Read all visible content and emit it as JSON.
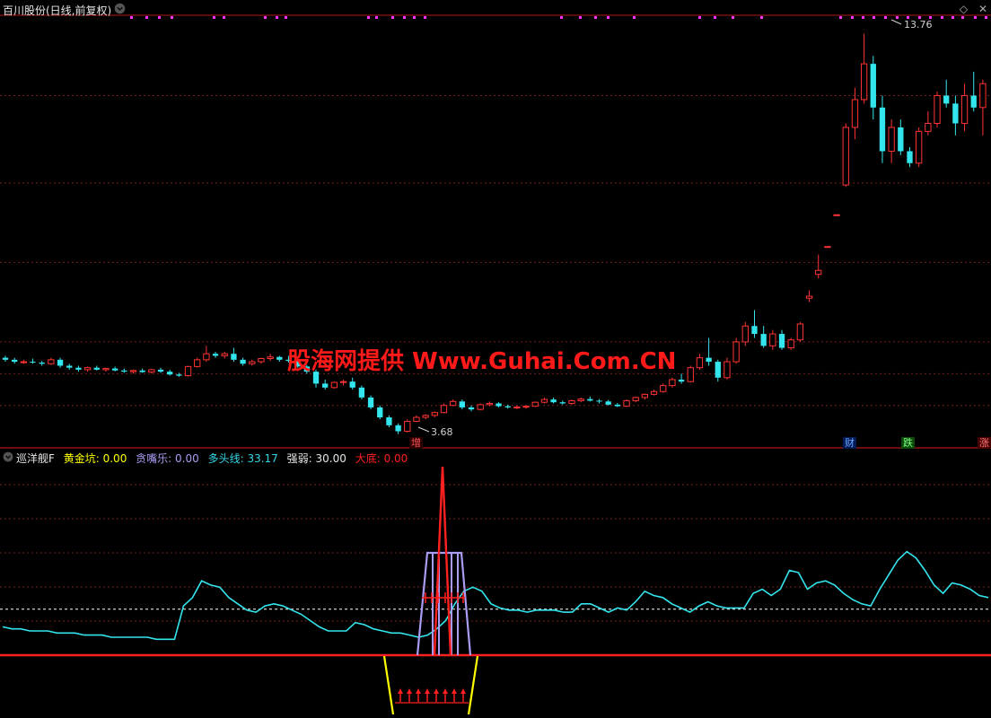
{
  "header": {
    "title": "百川股份(日线,前复权)",
    "window_controls": [
      "◇",
      "✕"
    ]
  },
  "price": {
    "high_label": "13.76",
    "low_label": "3.68"
  },
  "event_badges": {
    "zeng": "增",
    "cai": "财",
    "die": "跌",
    "zhang": "涨"
  },
  "indicator": {
    "name": "巡洋舰F",
    "items": [
      {
        "key": "黄金坑",
        "value": "0.00",
        "color": "#ffff00"
      },
      {
        "key": "贪嘴乐",
        "value": "0.00",
        "color": "#a99cf2"
      },
      {
        "key": "多头线",
        "value": "33.17",
        "color": "#33d6e6"
      },
      {
        "key": "强弱",
        "value": "30.00",
        "color": "#e6e6e6"
      },
      {
        "key": "大底",
        "value": "0.00",
        "color": "#ff2020"
      }
    ]
  },
  "watermark": "股海网提供 Www.Guhai.Com.CN",
  "colors": {
    "up": "#ff3333",
    "down": "#33e6ee",
    "grid": "#7a1f1f",
    "signal_dots": "#ff33ff"
  },
  "chart_data": {
    "type": "candlestick",
    "candles": [
      [
        5.6,
        5.65,
        5.5,
        5.55
      ],
      [
        5.55,
        5.6,
        5.45,
        5.5
      ],
      [
        5.5,
        5.55,
        5.45,
        5.5
      ],
      [
        5.5,
        5.58,
        5.45,
        5.48
      ],
      [
        5.48,
        5.52,
        5.4,
        5.45
      ],
      [
        5.45,
        5.6,
        5.42,
        5.55
      ],
      [
        5.55,
        5.6,
        5.35,
        5.4
      ],
      [
        5.4,
        5.45,
        5.3,
        5.35
      ],
      [
        5.35,
        5.4,
        5.25,
        5.3
      ],
      [
        5.3,
        5.38,
        5.25,
        5.35
      ],
      [
        5.35,
        5.4,
        5.28,
        5.3
      ],
      [
        5.3,
        5.35,
        5.25,
        5.33
      ],
      [
        5.33,
        5.38,
        5.26,
        5.28
      ],
      [
        5.28,
        5.33,
        5.22,
        5.25
      ],
      [
        5.25,
        5.3,
        5.2,
        5.28
      ],
      [
        5.28,
        5.33,
        5.22,
        5.24
      ],
      [
        5.24,
        5.32,
        5.2,
        5.3
      ],
      [
        5.3,
        5.35,
        5.22,
        5.25
      ],
      [
        5.25,
        5.3,
        5.15,
        5.18
      ],
      [
        5.18,
        5.22,
        5.12,
        5.15
      ],
      [
        5.15,
        5.4,
        5.12,
        5.38
      ],
      [
        5.38,
        5.6,
        5.35,
        5.55
      ],
      [
        5.55,
        5.9,
        5.5,
        5.7
      ],
      [
        5.7,
        5.75,
        5.6,
        5.65
      ],
      [
        5.65,
        5.75,
        5.58,
        5.7
      ],
      [
        5.7,
        5.85,
        5.5,
        5.55
      ],
      [
        5.55,
        5.6,
        5.4,
        5.45
      ],
      [
        5.45,
        5.55,
        5.4,
        5.5
      ],
      [
        5.5,
        5.6,
        5.45,
        5.58
      ],
      [
        5.58,
        5.7,
        5.52,
        5.62
      ],
      [
        5.62,
        5.65,
        5.5,
        5.55
      ],
      [
        5.55,
        5.65,
        5.48,
        5.52
      ],
      [
        5.52,
        5.55,
        5.35,
        5.38
      ],
      [
        5.38,
        5.42,
        5.2,
        5.25
      ],
      [
        5.25,
        5.3,
        4.85,
        4.95
      ],
      [
        4.95,
        5.05,
        4.8,
        4.85
      ],
      [
        4.85,
        5.0,
        4.82,
        4.98
      ],
      [
        4.98,
        5.05,
        4.9,
        5.0
      ],
      [
        5.0,
        5.1,
        4.8,
        4.85
      ],
      [
        4.85,
        4.9,
        4.55,
        4.6
      ],
      [
        4.6,
        4.65,
        4.3,
        4.35
      ],
      [
        4.35,
        4.4,
        4.05,
        4.1
      ],
      [
        4.1,
        4.15,
        3.85,
        3.9
      ],
      [
        3.9,
        3.95,
        3.68,
        3.75
      ],
      [
        3.75,
        4.05,
        3.72,
        4.0
      ],
      [
        4.0,
        4.15,
        3.98,
        4.1
      ],
      [
        4.1,
        4.18,
        4.05,
        4.15
      ],
      [
        4.15,
        4.25,
        4.1,
        4.22
      ],
      [
        4.22,
        4.45,
        4.2,
        4.4
      ],
      [
        4.4,
        4.55,
        4.38,
        4.5
      ],
      [
        4.5,
        4.55,
        4.3,
        4.35
      ],
      [
        4.35,
        4.4,
        4.25,
        4.3
      ],
      [
        4.3,
        4.45,
        4.28,
        4.42
      ],
      [
        4.42,
        4.5,
        4.38,
        4.45
      ],
      [
        4.45,
        4.48,
        4.35,
        4.38
      ],
      [
        4.38,
        4.42,
        4.32,
        4.35
      ],
      [
        4.35,
        4.4,
        4.3,
        4.36
      ],
      [
        4.36,
        4.4,
        4.32,
        4.38
      ],
      [
        4.38,
        4.5,
        4.36,
        4.48
      ],
      [
        4.48,
        4.6,
        4.45,
        4.55
      ],
      [
        4.55,
        4.6,
        4.45,
        4.48
      ],
      [
        4.48,
        4.52,
        4.42,
        4.45
      ],
      [
        4.45,
        4.55,
        4.42,
        4.52
      ],
      [
        4.52,
        4.6,
        4.48,
        4.56
      ],
      [
        4.56,
        4.62,
        4.5,
        4.52
      ],
      [
        4.52,
        4.56,
        4.45,
        4.5
      ],
      [
        4.5,
        4.54,
        4.4,
        4.42
      ],
      [
        4.42,
        4.46,
        4.36,
        4.38
      ],
      [
        4.38,
        4.55,
        4.36,
        4.52
      ],
      [
        4.52,
        4.62,
        4.48,
        4.6
      ],
      [
        4.6,
        4.7,
        4.55,
        4.68
      ],
      [
        4.68,
        4.8,
        4.65,
        4.75
      ],
      [
        4.75,
        4.95,
        4.72,
        4.9
      ],
      [
        4.9,
        5.1,
        4.85,
        5.05
      ],
      [
        5.05,
        5.2,
        4.95,
        5.0
      ],
      [
        5.0,
        5.4,
        4.98,
        5.35
      ],
      [
        5.35,
        5.7,
        5.3,
        5.6
      ],
      [
        5.6,
        6.1,
        5.4,
        5.5
      ],
      [
        5.5,
        5.55,
        5.0,
        5.1
      ],
      [
        5.1,
        5.6,
        5.05,
        5.5
      ],
      [
        5.5,
        6.1,
        5.45,
        6.0
      ],
      [
        6.0,
        6.5,
        5.9,
        6.4
      ],
      [
        6.4,
        6.8,
        6.1,
        6.2
      ],
      [
        6.2,
        6.4,
        5.85,
        5.9
      ],
      [
        5.9,
        6.3,
        5.8,
        6.2
      ],
      [
        6.2,
        6.3,
        5.8,
        5.85
      ],
      [
        5.85,
        6.1,
        5.8,
        6.05
      ],
      [
        6.05,
        6.5,
        6.0,
        6.45
      ],
      [
        7.1,
        7.3,
        7.0,
        7.15
      ],
      [
        7.7,
        8.2,
        7.6,
        7.8
      ],
      [
        8.4,
        8.4,
        8.4,
        8.4
      ],
      [
        9.2,
        9.2,
        9.2,
        9.2
      ],
      [
        9.95,
        11.5,
        9.9,
        11.4
      ],
      [
        11.4,
        12.4,
        11.1,
        12.1
      ],
      [
        12.1,
        13.76,
        12.0,
        13.0
      ],
      [
        13.0,
        13.2,
        11.6,
        11.9
      ],
      [
        11.9,
        12.2,
        10.5,
        10.8
      ],
      [
        10.8,
        11.6,
        10.5,
        11.4
      ],
      [
        11.4,
        11.6,
        10.7,
        10.8
      ],
      [
        10.8,
        10.9,
        10.4,
        10.5
      ],
      [
        10.5,
        11.4,
        10.4,
        11.3
      ],
      [
        11.3,
        11.8,
        11.2,
        11.5
      ],
      [
        11.5,
        12.3,
        11.4,
        12.2
      ],
      [
        12.2,
        12.6,
        11.9,
        12.0
      ],
      [
        12.0,
        12.2,
        11.2,
        11.5
      ],
      [
        11.5,
        12.5,
        11.3,
        12.2
      ],
      [
        12.2,
        12.8,
        11.8,
        11.9
      ],
      [
        11.9,
        12.6,
        11.2,
        12.5
      ]
    ],
    "price_range": [
      3.4,
      14.2
    ],
    "multi_line": [
      22,
      21,
      21,
      20,
      20,
      20,
      19,
      19,
      19,
      18,
      18,
      18,
      17,
      17,
      17,
      17,
      17,
      16,
      16,
      16,
      32,
      36,
      44,
      42,
      41,
      36,
      33,
      30,
      29,
      32,
      33,
      32,
      30,
      28,
      25,
      22,
      20,
      20,
      20,
      24,
      23,
      21,
      20,
      19,
      19,
      18,
      17,
      18,
      21,
      25,
      33,
      39,
      41,
      39,
      33,
      31,
      30,
      30,
      29,
      30,
      30,
      30,
      29,
      29,
      33,
      33,
      31,
      29,
      31,
      30,
      34,
      39,
      37,
      36,
      33,
      31,
      29,
      32,
      34,
      32,
      31,
      31,
      31,
      38,
      40,
      37,
      40,
      49,
      48,
      40,
      43,
      44,
      42,
      38,
      35,
      33,
      32,
      40,
      47,
      54,
      58,
      55,
      49,
      42,
      38,
      43,
      42,
      40,
      37,
      36
    ],
    "qiangruo_level": 30.0,
    "indicator_range": [
      -20,
      100
    ]
  }
}
